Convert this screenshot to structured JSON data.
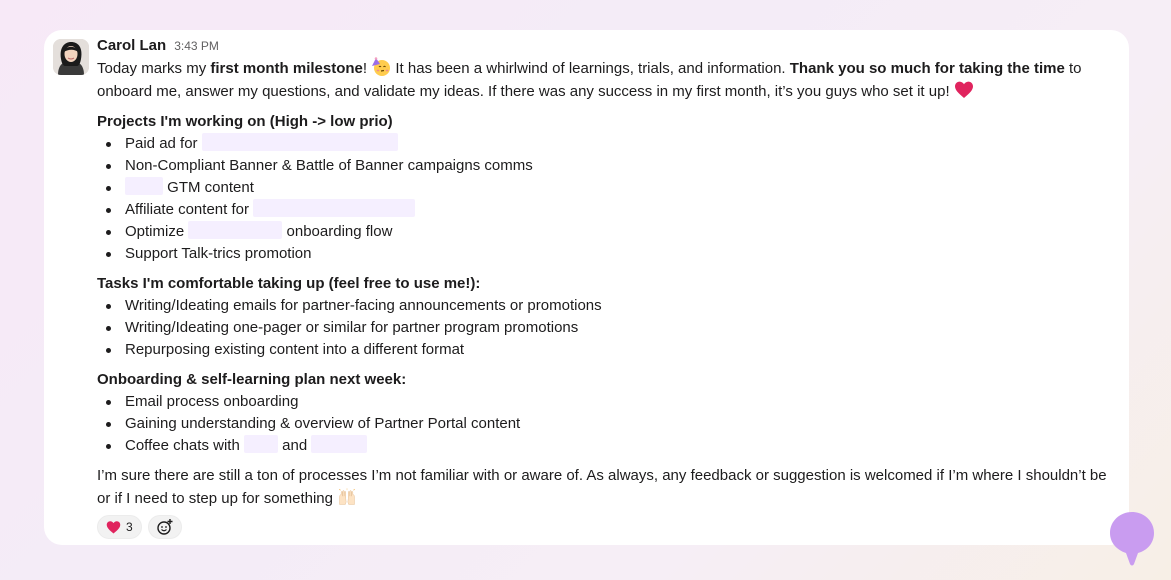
{
  "message": {
    "author": "Carol Lan",
    "timestamp": "3:43 PM",
    "intro": {
      "t1": "Today marks my ",
      "b1": "first month milestone",
      "t2": "! ",
      "t3": " It has been a whirlwind of learnings, trials, and information. ",
      "b2": "Thank you so much for taking the time",
      "t4": " to onboard me, answer my questions, and validate my ideas. If there was any success in my first month, it’s you guys who set it up! "
    },
    "sections": [
      {
        "title": "Projects I'm working on (High -> low prio)",
        "items": [
          {
            "before": "Paid ad for",
            "after": ""
          },
          {
            "text": "Non-Compliant Banner & Battle of Banner campaigns comms"
          },
          {
            "before": "",
            "after": "GTM content"
          },
          {
            "before": "Affiliate content for",
            "after": ""
          },
          {
            "before": "Optimize",
            "after": "onboarding flow"
          },
          {
            "text": "Support Talk-trics promotion"
          }
        ]
      },
      {
        "title": "Tasks I'm comfortable taking up (feel free to use me!):",
        "items": [
          "Writing/Ideating emails for partner-facing announcements or promotions",
          "Writing/Ideating one-pager or similar for partner program promotions",
          "Repurposing existing content into a different format"
        ]
      },
      {
        "title": "Onboarding & self-learning plan next week:",
        "items": [
          {
            "text": "Email process onboarding"
          },
          {
            "text": "Gaining understanding & overview of Partner Portal content"
          },
          {
            "before": "Coffee chats with",
            "middle": "and"
          }
        ]
      }
    ],
    "closing": "I’m sure there are still a ton of processes I’m not familiar with or aware of. As always, any feedback or suggestion is welcomed if I’m where I shouldn’t be or if I need to step up for something ",
    "reactions": [
      {
        "emoji": "heart-icon",
        "count": "3"
      }
    ],
    "icons": {
      "party": "partying-face-icon",
      "heart": "heart-icon",
      "hands": "raising-hands-icon",
      "add_reaction": "add-reaction-icon"
    }
  },
  "colors": {
    "accent_bubble": "#c99cf0",
    "heart": "#e0245e",
    "redaction": "#f5efff"
  }
}
